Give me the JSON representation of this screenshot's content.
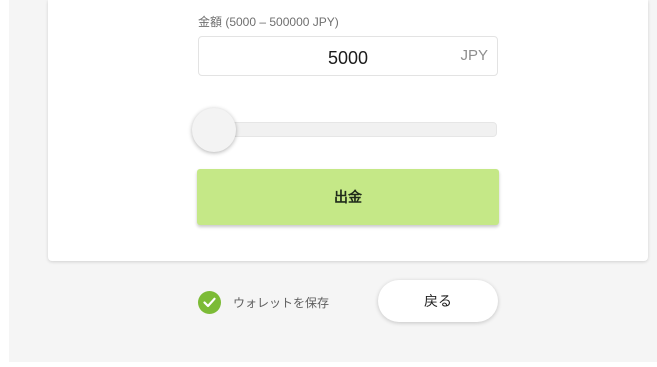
{
  "form": {
    "amount_label": "金額 (5000 – 500000 JPY)",
    "amount_value": "5000",
    "currency": "JPY",
    "slider_value": 5000,
    "slider_min": 5000,
    "slider_max": 500000,
    "withdraw_label": "出金"
  },
  "footer": {
    "save_wallet_label": "ウォレットを保存",
    "save_wallet_checked": true,
    "back_label": "戻る"
  },
  "colors": {
    "accent": "#c5e887",
    "check": "#7cbb36",
    "background": "#f5f5f5"
  },
  "icons": {
    "save_wallet": "check-circle-icon"
  }
}
